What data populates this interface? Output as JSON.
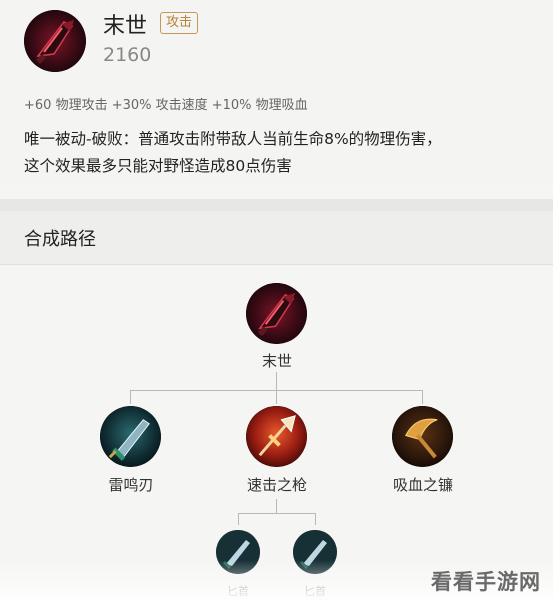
{
  "item": {
    "name": "末世",
    "tag": "攻击",
    "price": "2160",
    "stats": "+60 物理攻击 +30% 攻击速度 +10% 物理吸血",
    "passive_line1": "唯一被动-破败：普通攻击附带敌人当前生命8%的物理伤害，",
    "passive_line2": "这个效果最多只能对野怪造成80点伤害",
    "icon": "doomsday-sword-icon"
  },
  "section": {
    "title": "合成路径"
  },
  "tree": {
    "root": {
      "label": "末世",
      "icon": "doomsday-sword-icon"
    },
    "children": [
      {
        "label": "雷鸣刃",
        "icon": "thunder-blade-icon"
      },
      {
        "label": "速击之枪",
        "icon": "swift-spear-icon"
      },
      {
        "label": "吸血之镰",
        "icon": "lifesteal-scythe-icon"
      }
    ],
    "grandchildren": [
      {
        "label": "匕首",
        "icon": "dagger-icon"
      },
      {
        "label": "匕首",
        "icon": "dagger-icon"
      }
    ]
  },
  "watermark": "看看手游网",
  "colors": {
    "tag_border": "#c49a52",
    "tag_text": "#b6843c",
    "line": "#b9b9b9"
  }
}
